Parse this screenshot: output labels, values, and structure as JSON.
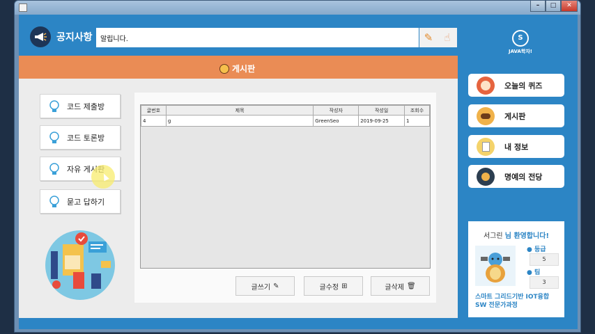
{
  "notice": {
    "title": "공지사항",
    "text": "알립니다."
  },
  "logo": {
    "mark": "S",
    "text": "JAVA학자!"
  },
  "board": {
    "title": "게시판"
  },
  "left_nav": [
    {
      "label": "코드 제출방"
    },
    {
      "label": "코드 토론방"
    },
    {
      "label": "자유 게시판"
    },
    {
      "label": "묻고 답하기"
    }
  ],
  "table": {
    "headers": [
      "글번호",
      "제목",
      "작성자",
      "작성일",
      "조회수"
    ],
    "rows": [
      [
        "4",
        "g",
        "GreenSeo",
        "2019-09-25",
        "1"
      ]
    ]
  },
  "actions": {
    "write": "글쓰기",
    "edit": "글수정",
    "delete": "글삭제"
  },
  "right_nav": [
    {
      "label": "오늘의 퀴즈"
    },
    {
      "label": "게시판"
    },
    {
      "label": "내 정보"
    },
    {
      "label": "명예의 전당"
    }
  ],
  "profile": {
    "user": "서그린",
    "welcome_suffix": "님 환영합니다!",
    "grade_label": "등급",
    "grade": "5",
    "team_label": "팀",
    "team": "3",
    "course_line1": "스마트 그리드기반 IOT융합",
    "course_line2": "SW 전문가과정"
  },
  "colors": {
    "primary": "#2c85c5",
    "accent": "#ea8c55"
  }
}
